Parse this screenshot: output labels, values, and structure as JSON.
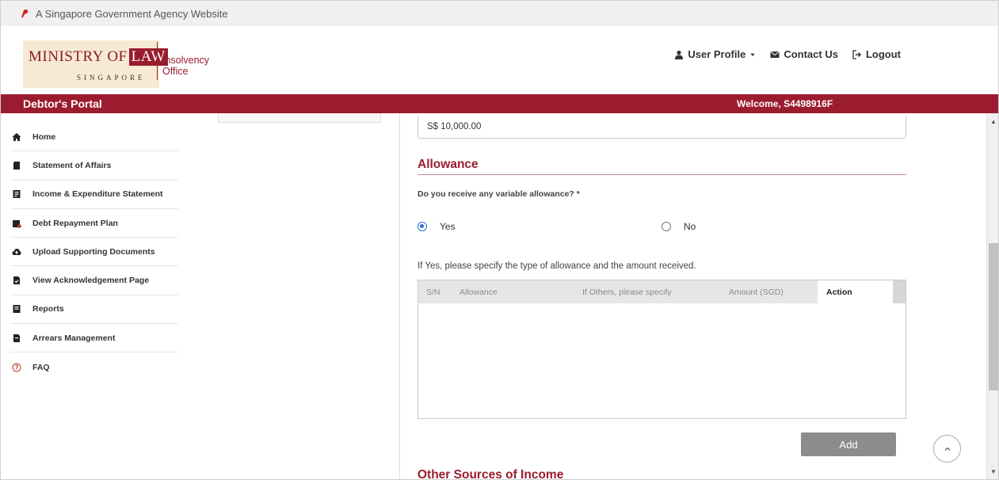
{
  "masthead": {
    "text": "A Singapore Government Agency Website"
  },
  "logo": {
    "line1": "MINISTRY OF",
    "line1_box": "LAW",
    "line2": "SINGAPORE",
    "sub1": "Insolvency",
    "sub2": "Office"
  },
  "topnav": {
    "user_profile": "User Profile",
    "contact": "Contact Us",
    "logout": "Logout"
  },
  "portal": {
    "title": "Debtor's Portal",
    "welcome": "Welcome, S4498916F"
  },
  "sidebar": {
    "items": [
      {
        "label": "Home",
        "icon": "home-icon"
      },
      {
        "label": "Statement of Affairs",
        "icon": "document-icon"
      },
      {
        "label": "Income & Expenditure Statement",
        "icon": "ledger-icon"
      },
      {
        "label": "Debt Repayment Plan",
        "icon": "calendar-icon"
      },
      {
        "label": "Upload Supporting Documents",
        "icon": "cloud-upload-icon"
      },
      {
        "label": "View Acknowledgement Page",
        "icon": "file-check-icon"
      },
      {
        "label": "Reports",
        "icon": "report-icon"
      },
      {
        "label": "Arrears Management",
        "icon": "file-icon"
      },
      {
        "label": "FAQ",
        "icon": "question-icon"
      }
    ]
  },
  "main": {
    "amount_value": "S$ 10,000.00",
    "section_title": "Allowance",
    "question": "Do you receive any variable allowance? *",
    "options": {
      "yes": "Yes",
      "no": "No",
      "selected": "Yes"
    },
    "hint": "If Yes, please specify the type of allowance and the amount received.",
    "table": {
      "headers": [
        "S/N",
        "Allowance",
        "If Others, please specify",
        "Amount (SGD)",
        "Action"
      ],
      "rows": []
    },
    "add_label": "Add",
    "next_section_title": "Other Sources of Income"
  },
  "colors": {
    "brand": "#9b1c2e",
    "radio_selected": "#2a6fd6",
    "button": "#8c8c8c"
  }
}
